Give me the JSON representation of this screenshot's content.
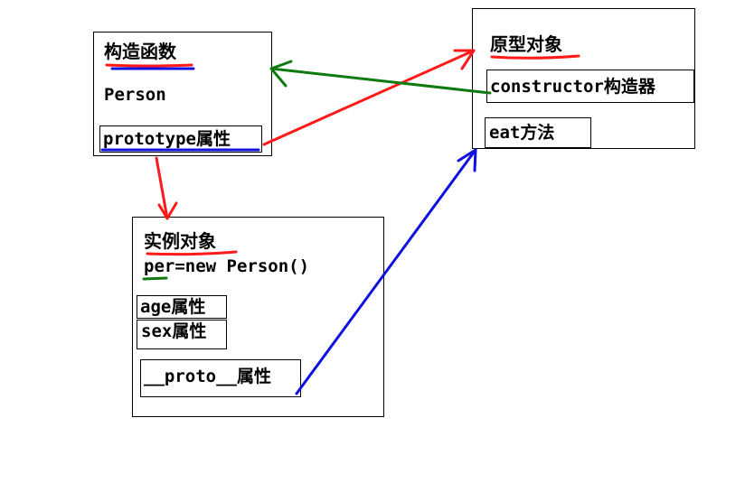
{
  "diagram": {
    "constructor_box": {
      "title": "构造函数",
      "name": "Person",
      "prototype_prop": "prototype属性"
    },
    "prototype_box": {
      "title": "原型对象",
      "constructor_prop": "constructor构造器",
      "method": "eat方法"
    },
    "instance_box": {
      "title": "实例对象",
      "code": "per=new Person()",
      "prop_age": "age属性",
      "prop_sex": "sex属性",
      "prop_proto": "__proto__属性"
    },
    "colors": {
      "red": "#ff1a1a",
      "green": "#0f7a0f",
      "blue": "#1010e0",
      "line": "#000000"
    }
  }
}
